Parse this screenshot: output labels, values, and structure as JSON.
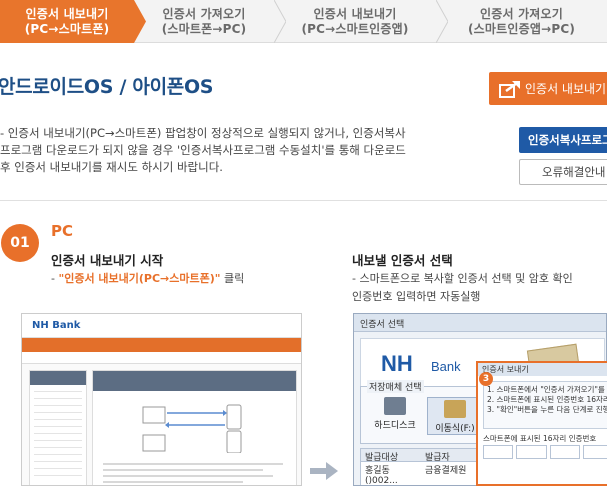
{
  "tabs": [
    {
      "line1": "인증서 내보내기",
      "line2": "(PC→스마트폰)",
      "active": true
    },
    {
      "line1": "인증서 가져오기",
      "line2": "(스마트폰→PC)",
      "active": false
    },
    {
      "line1": "인증서 내보내기",
      "line2": "(PC→스마트인증앱)",
      "active": false
    },
    {
      "line1": "인증서 가져오기",
      "line2": "(스마트인증앱→PC)",
      "active": false
    }
  ],
  "header": {
    "title": "안드로이드OS / 아이폰OS",
    "export_button": "인증서 내보내기"
  },
  "description": [
    "- 인증서 내보내기(PC→스마트폰) 팝업창이 정상적으로 실행되지 않거나, 인증서복사",
    "  프로그램 다운로드가 되지 않을 경우 '인증서복사프로그램 수동설치'를 통해 다운로드",
    "  후 인증서 내보내기를 재시도 하시기 바랍니다."
  ],
  "buttons": {
    "copy_program": "인증서복사프로그램",
    "error_guide": "오류해결안내"
  },
  "step": {
    "number": "01",
    "label": "PC"
  },
  "section1": {
    "title": "인증서 내보내기 시작",
    "prefix": "- ",
    "highlight": "\"인증서 내보내기(PC→스마트폰)\"",
    "suffix": " 클릭"
  },
  "section2": {
    "title": "내보낼 인증서 선택",
    "line1": "- 스마트폰으로 복사할 인증서 선택 및 암호 확인",
    "line2": "  인증번호 입력하면 자동실행"
  },
  "screenshot1": {
    "logo": "NH Bank"
  },
  "screenshot2": {
    "window_title": "인증서 선택",
    "brand": "NH",
    "brand_sub": "Bank",
    "storage_label": "저장매체 선택",
    "hdd_label": "하드디스크",
    "mobile_label": "이동식(F:)",
    "col1": "발급대상",
    "col2": "발급자",
    "row_subject": "홍길동 ()002...",
    "row_issuer": "금융결제원",
    "popup_title": "인증서 보내기",
    "popup_badge": "3",
    "popup_lines": [
      "1. 스마트폰에서 \"인증서 가져오기\"를 선택",
      "2. 스마트폰에 표시된 인증번호 16자리",
      "3. \"확인\"버튼을 누른 다음 단계로 진행"
    ],
    "popup_code_label": "스마트폰에 표시된 16자리 인증번호"
  }
}
